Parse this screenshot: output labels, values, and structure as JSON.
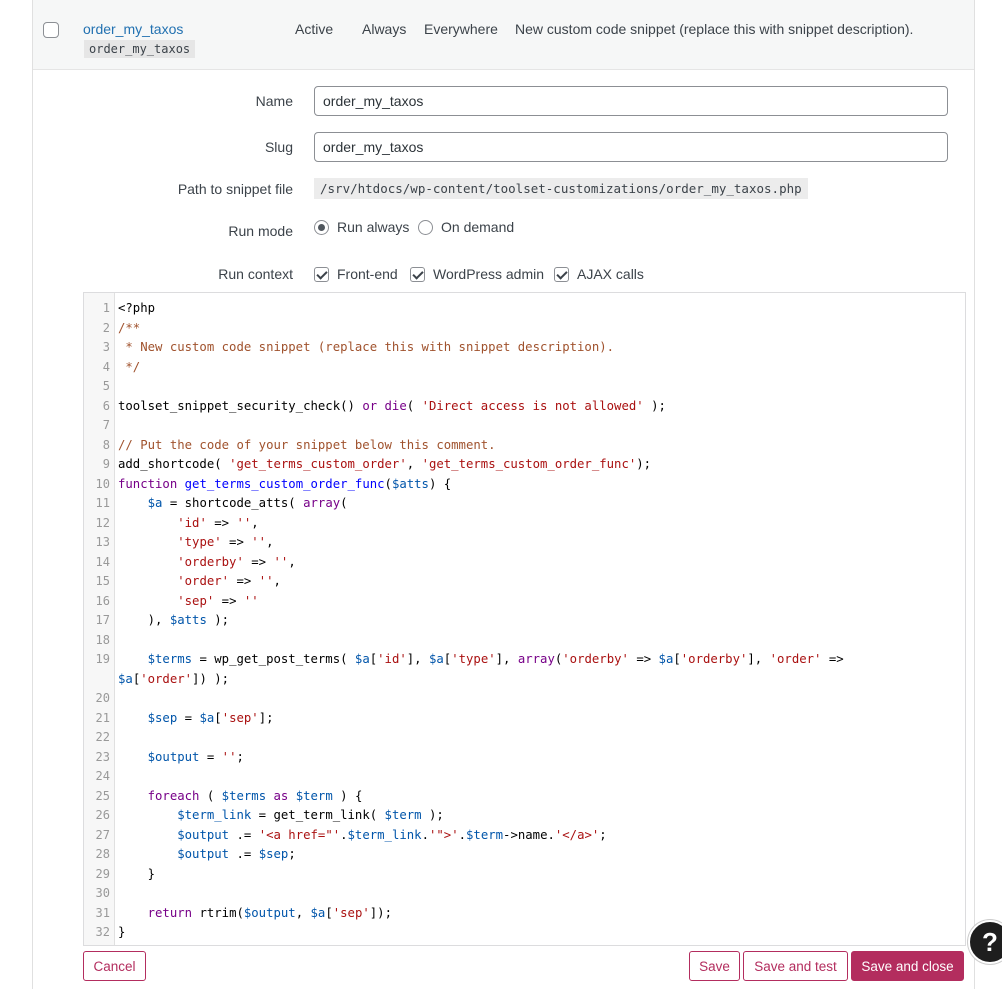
{
  "snippet_row": {
    "title": "order_my_taxos",
    "slug": "order_my_taxos",
    "status": "Active",
    "run_mode": "Always",
    "context": "Everywhere",
    "description": "New custom code snippet (replace this with snippet description)."
  },
  "form": {
    "name_label": "Name",
    "name_value": "order_my_taxos",
    "slug_label": "Slug",
    "slug_value": "order_my_taxos",
    "path_label": "Path to snippet file",
    "path_value": "/srv/htdocs/wp-content/toolset-customizations/order_my_taxos.php",
    "run_mode_label": "Run mode",
    "run_always_label": "Run always",
    "on_demand_label": "On demand",
    "run_context_label": "Run context",
    "frontend_label": "Front-end",
    "wpadmin_label": "WordPress admin",
    "ajax_label": "AJAX calls"
  },
  "code_lines": [
    {
      "n": "1",
      "t": "<?php"
    },
    {
      "n": "2",
      "t": "/**"
    },
    {
      "n": "3",
      "t": " * New custom code snippet (replace this with snippet description)."
    },
    {
      "n": "4",
      "t": " */"
    },
    {
      "n": "5",
      "t": ""
    },
    {
      "n": "6",
      "t": "toolset_snippet_security_check() or die( 'Direct access is not allowed' );"
    },
    {
      "n": "7",
      "t": ""
    },
    {
      "n": "8",
      "t": "// Put the code of your snippet below this comment."
    },
    {
      "n": "9",
      "t": "add_shortcode( 'get_terms_custom_order', 'get_terms_custom_order_func');"
    },
    {
      "n": "10",
      "t": "function get_terms_custom_order_func($atts) {"
    },
    {
      "n": "11",
      "t": "    $a = shortcode_atts( array("
    },
    {
      "n": "12",
      "t": "        'id' => '',"
    },
    {
      "n": "13",
      "t": "        'type' => '',"
    },
    {
      "n": "14",
      "t": "        'orderby' => '',"
    },
    {
      "n": "15",
      "t": "        'order' => '',"
    },
    {
      "n": "16",
      "t": "        'sep' => ''"
    },
    {
      "n": "17",
      "t": "    ), $atts );"
    },
    {
      "n": "18",
      "t": ""
    },
    {
      "n": "19",
      "t": "    $terms = wp_get_post_terms( $a['id'], $a['type'], array('orderby' => $a['orderby'], 'order' => $a['order']) );"
    },
    {
      "n": "20",
      "t": ""
    },
    {
      "n": "21",
      "t": "    $sep = $a['sep'];"
    },
    {
      "n": "22",
      "t": ""
    },
    {
      "n": "23",
      "t": "    $output = '';"
    },
    {
      "n": "24",
      "t": ""
    },
    {
      "n": "25",
      "t": "    foreach ( $terms as $term ) {"
    },
    {
      "n": "26",
      "t": "        $term_link = get_term_link( $term );"
    },
    {
      "n": "27",
      "t": "        $output .= '<a href=\"'.$term_link.'\">'.$term->name.'</a>';"
    },
    {
      "n": "28",
      "t": "        $output .= $sep;"
    },
    {
      "n": "29",
      "t": "    }"
    },
    {
      "n": "30",
      "t": ""
    },
    {
      "n": "31",
      "t": "    return rtrim($output, $a['sep']);"
    },
    {
      "n": "32",
      "t": "}"
    }
  ],
  "buttons": {
    "cancel": "Cancel",
    "save": "Save",
    "save_test": "Save and test",
    "save_close": "Save and close"
  },
  "help": "?",
  "colors": {
    "accent": "#b32d5e",
    "link": "#2271b1"
  }
}
